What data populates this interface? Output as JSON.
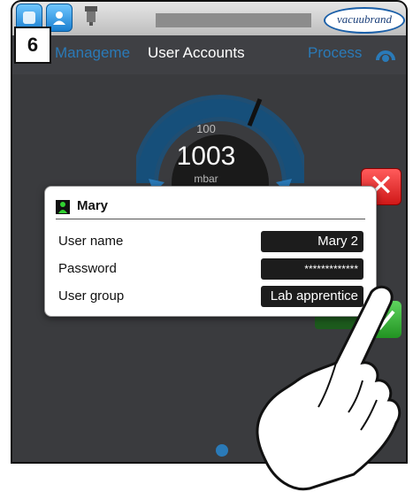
{
  "step_number": "6",
  "header": {
    "brand_logo_text": "vacuubrand",
    "icons": [
      "process-icon",
      "user-icon",
      "network-icon"
    ]
  },
  "subheader": {
    "left_label": "Manageme",
    "title": "User Accounts",
    "right_label": "Process"
  },
  "gauge": {
    "setpoint": "100",
    "value": "1003",
    "unit": "mbar"
  },
  "dialog": {
    "user_name_title": "Mary",
    "fields": [
      {
        "label": "User name",
        "value": "Mary 2"
      },
      {
        "label": "Password",
        "value": "*************"
      },
      {
        "label": "User group",
        "value": "Lab apprentice"
      }
    ]
  },
  "buttons": {
    "close": "✕",
    "ok": "✓"
  },
  "colors": {
    "accent_blue": "#2a7ab8",
    "close_red": "#e02222",
    "ok_green": "#3cb43c",
    "panel_dark": "#3a3b3e"
  }
}
